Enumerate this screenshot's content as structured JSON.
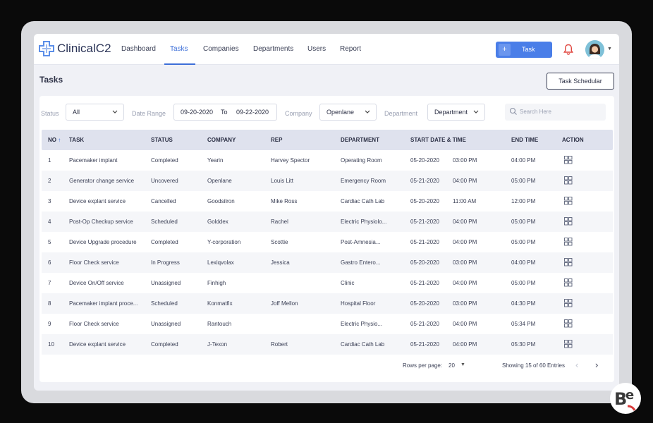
{
  "brand": {
    "name": "ClinicalC2"
  },
  "nav": {
    "items": [
      {
        "label": "Dashboard"
      },
      {
        "label": "Tasks"
      },
      {
        "label": "Companies"
      },
      {
        "label": "Departments"
      },
      {
        "label": "Users"
      },
      {
        "label": "Report"
      }
    ],
    "active": "Tasks"
  },
  "header": {
    "task_button": "Task",
    "plus_icon": "+"
  },
  "page": {
    "title": "Tasks",
    "scheduler_button": "Task Schedular"
  },
  "filters": {
    "status_label": "Status",
    "status_value": "All",
    "date_label": "Date Range",
    "date_from": "09-20-2020",
    "date_to_label": "To",
    "date_to": "09-22-2020",
    "company_label": "Company",
    "company_value": "Openlane",
    "department_label": "Department",
    "department_value": "Department",
    "search_placeholder": "Search Here"
  },
  "table": {
    "columns": [
      "NO",
      "TASK",
      "STATUS",
      "COMPANY",
      "REP",
      "DEPARTMENT",
      "START DATE & TIME",
      "END TIME",
      "ACTION"
    ],
    "sort_indicator": "↑",
    "rows": [
      {
        "no": "1",
        "task": "Pacemaker implant",
        "status": "Completed",
        "company": "Yearin",
        "rep": "Harvey Spector",
        "department": "Operating Room",
        "start_date": "05-20-2020",
        "start_time": "03:00 PM",
        "end_time": "04:00 PM"
      },
      {
        "no": "2",
        "task": "Generator change service",
        "status": "Uncovered",
        "company": "Openlane",
        "rep": "Louis Litt",
        "department": "Emergency Room",
        "start_date": "05-21-2020",
        "start_time": "04:00 PM",
        "end_time": "05:00 PM"
      },
      {
        "no": "3",
        "task": "Device explant service",
        "status": "Cancelled",
        "company": "Goodsilron",
        "rep": "Mike Ross",
        "department": "Cardiac Cath Lab",
        "start_date": "05-20-2020",
        "start_time": "11:00 AM",
        "end_time": "12:00 PM"
      },
      {
        "no": "4",
        "task": "Post-Op Checkup service",
        "status": "Scheduled",
        "company": "Golddex",
        "rep": "Rachel",
        "department": "Electric Physiolo...",
        "start_date": "05-21-2020",
        "start_time": "04:00 PM",
        "end_time": "05:00 PM"
      },
      {
        "no": "5",
        "task": "Device Upgrade procedure",
        "status": "Completed",
        "company": "Y-corporation",
        "rep": "Scottie",
        "department": "Post-Amnesia...",
        "start_date": "05-21-2020",
        "start_time": "04:00 PM",
        "end_time": "05:00 PM"
      },
      {
        "no": "6",
        "task": "Floor Check service",
        "status": "In Progress",
        "company": "Lexiqvolax",
        "rep": "Jessica",
        "department": "Gastro Entero...",
        "start_date": "05-20-2020",
        "start_time": "03:00 PM",
        "end_time": "04:00 PM"
      },
      {
        "no": "7",
        "task": "Device On/Off service",
        "status": "Unassigned",
        "company": "Finhigh",
        "rep": "",
        "department": "Clinic",
        "start_date": "05-21-2020",
        "start_time": "04:00 PM",
        "end_time": "05:00 PM"
      },
      {
        "no": "8",
        "task": "Pacemaker implant proce...",
        "status": "Scheduled",
        "company": "Konmatfix",
        "rep": "Joff Mellon",
        "department": "Hospital Floor",
        "start_date": "05-20-2020",
        "start_time": "03:00 PM",
        "end_time": "04:30 PM"
      },
      {
        "no": "9",
        "task": "Floor Check service",
        "status": "Unassigned",
        "company": "Rantouch",
        "rep": "",
        "department": "Electric Physio...",
        "start_date": "05-21-2020",
        "start_time": "04:00 PM",
        "end_time": "05:34 PM"
      },
      {
        "no": "10",
        "task": "Device explant service",
        "status": "Completed",
        "company": "J-Texon",
        "rep": "Robert",
        "department": "Cardiac Cath Lab",
        "start_date": "05-21-2020",
        "start_time": "04:00 PM",
        "end_time": "05:30 PM"
      }
    ]
  },
  "pagination": {
    "rows_per_page_label": "Rows per page:",
    "rows_per_page_value": "20",
    "showing": "Showing 15 of 60 Entries",
    "prev": "‹",
    "next": "›"
  },
  "watermark": {
    "text": "Bē"
  },
  "colors": {
    "accent": "#3d6fd8",
    "button": "#4a7ee8",
    "header_row": "#dfe2ee",
    "bell": "#e0463f"
  },
  "icons": [
    "cross-logo-icon",
    "plus-icon",
    "bell-icon",
    "chevron-down-icon",
    "search-icon",
    "grid-action-icon",
    "chevron-left-icon",
    "chevron-right-icon"
  ]
}
